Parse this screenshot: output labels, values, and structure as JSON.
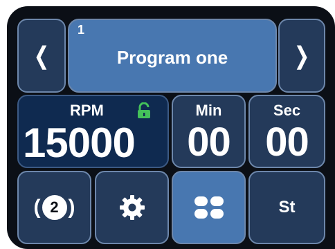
{
  "program": {
    "number": "1",
    "title": "Program one"
  },
  "nav": {
    "prev_glyph": "❬",
    "next_glyph": "❭"
  },
  "rpm": {
    "label": "RPM",
    "value": "15000",
    "locked": false
  },
  "timer": {
    "min_label": "Min",
    "min_value": "00",
    "sec_label": "Sec",
    "sec_value": "00"
  },
  "bottom": {
    "badge_number": "2",
    "settings_icon": "gear-icon",
    "grid_icon": "four-dots-icon",
    "st_label": "St"
  },
  "colors": {
    "frame": "#0b0f16",
    "tile_dark": "#243a5a",
    "tile_light": "#4877b0",
    "rpm_tile": "#0f2a50",
    "lock": "#44c25a"
  }
}
